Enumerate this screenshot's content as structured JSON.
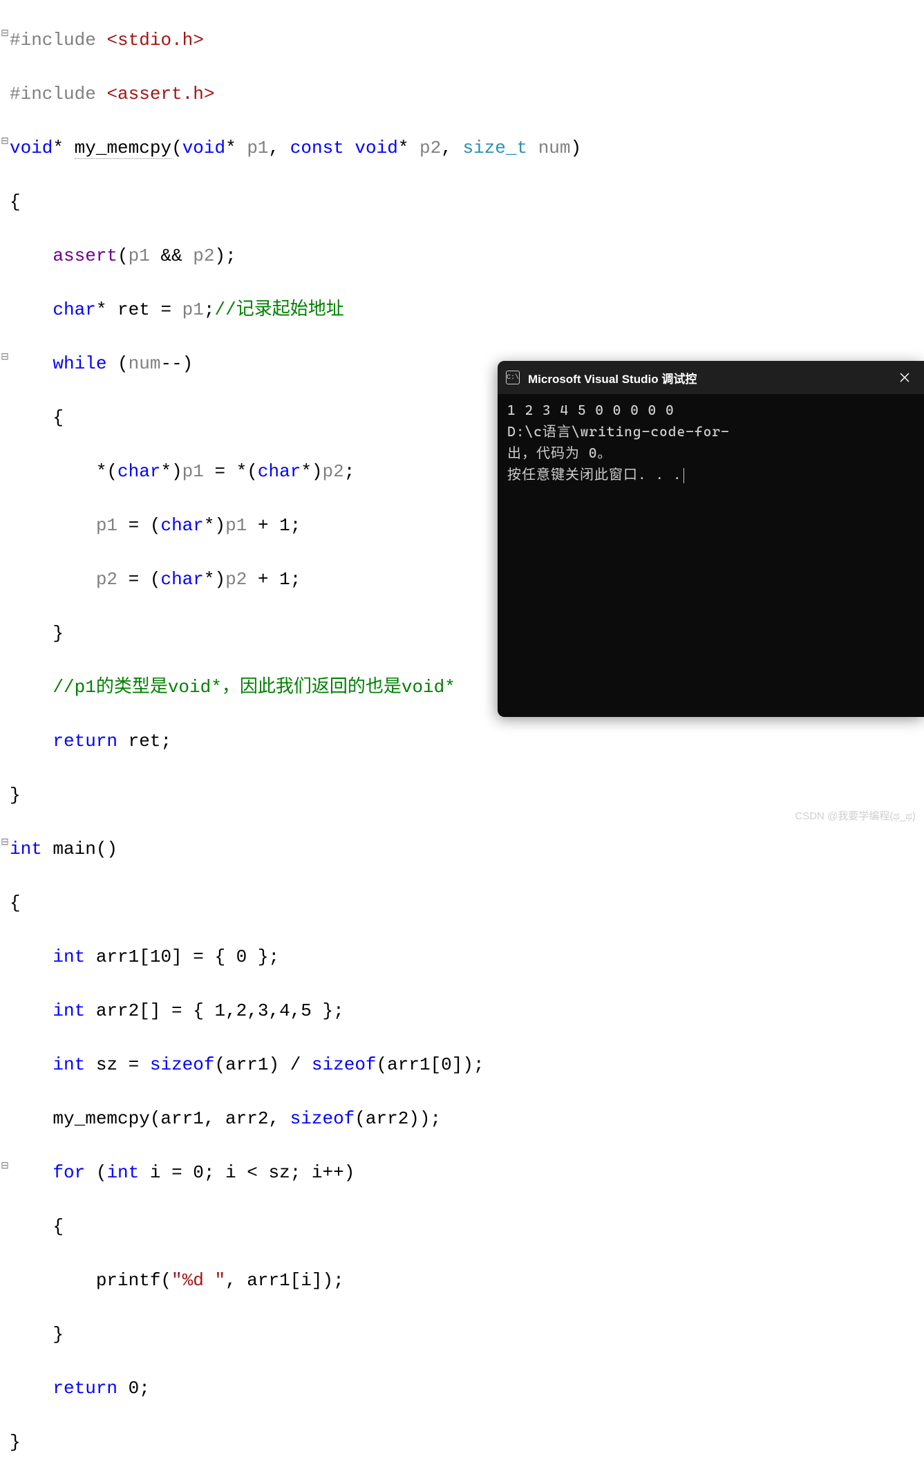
{
  "code": {
    "l1_gutter": "⊟",
    "l1_preproc": "#include ",
    "l1_path": "<stdio.h>",
    "l2_preproc": "#include ",
    "l2_path": "<assert.h>",
    "l3_gutter": "⊟",
    "l3_a": "void",
    "l3_b": "* ",
    "l3_c": "my_memcpy",
    "l3_d": "(",
    "l3_e": "void",
    "l3_f": "* ",
    "l3_g": "p1",
    "l3_h": ", ",
    "l3_i": "const",
    "l3_j": " ",
    "l3_k": "void",
    "l3_l": "* ",
    "l3_m": "p2",
    "l3_n": ", ",
    "l3_o": "size_t",
    "l3_p": " ",
    "l3_q": "num",
    "l3_r": ")",
    "l4": "{",
    "l5_a": "    ",
    "l5_b": "assert",
    "l5_c": "(",
    "l5_d": "p1",
    "l5_e": " && ",
    "l5_f": "p2",
    "l5_g": ");",
    "l6_a": "    ",
    "l6_b": "char",
    "l6_c": "* ret = ",
    "l6_d": "p1",
    "l6_e": ";",
    "l6_f": "//记录起始地址",
    "l7_gutter": "⊟",
    "l7_a": "    ",
    "l7_b": "while",
    "l7_c": " (",
    "l7_d": "num",
    "l7_e": "--)",
    "l8": "    {",
    "l9_a": "        *(",
    "l9_b": "char",
    "l9_c": "*)",
    "l9_d": "p1",
    "l9_e": " = *(",
    "l9_f": "char",
    "l9_g": "*)",
    "l9_h": "p2",
    "l9_i": ";",
    "l10_a": "        ",
    "l10_b": "p1",
    "l10_c": " = (",
    "l10_d": "char",
    "l10_e": "*)",
    "l10_f": "p1",
    "l10_g": " + 1;",
    "l11_a": "        ",
    "l11_b": "p2",
    "l11_c": " = (",
    "l11_d": "char",
    "l11_e": "*)",
    "l11_f": "p2",
    "l11_g": " + 1;",
    "l12": "    }",
    "l13_a": "    ",
    "l13_b": "//p1的类型是void*，因此我们返回的也是void*",
    "l14_a": "    ",
    "l14_b": "return",
    "l14_c": " ret;",
    "l15": "}",
    "l16_gutter": "⊟",
    "l16_a": "int",
    "l16_b": " main()",
    "l17": "{",
    "l18_a": "    ",
    "l18_b": "int",
    "l18_c": " arr1[10] = { 0 };",
    "l19_a": "    ",
    "l19_b": "int",
    "l19_c": " arr2[] = { 1,2,3,4,5 };",
    "l20_a": "    ",
    "l20_b": "int",
    "l20_c": " sz = ",
    "l20_d": "sizeof",
    "l20_e": "(arr1) / ",
    "l20_f": "sizeof",
    "l20_g": "(arr1[0]);",
    "l21_a": "    my_memcpy(arr1, arr2, ",
    "l21_b": "sizeof",
    "l21_c": "(arr2));",
    "l22_gutter": "⊟",
    "l22_a": "    ",
    "l22_b": "for",
    "l22_c": " (",
    "l22_d": "int",
    "l22_e": " i = 0; i < sz; i++)",
    "l23": "    {",
    "l24_a": "        printf(",
    "l24_b": "\"%d \"",
    "l24_c": ", arr1[i]);",
    "l25": "    }",
    "l26_a": "    ",
    "l26_b": "return",
    "l26_c": " 0;",
    "l27": "}"
  },
  "console": {
    "title": "Microsoft Visual Studio 调试控",
    "icon_text": "C:\\",
    "line1": "1 2 3 4 5 0 0 0 0 0",
    "line2": "D:\\c语言\\writing-code-for-",
    "line3": "出，代码为 0。",
    "line4": "按任意键关闭此窗口. . ."
  },
  "watermark": "CSDN @我要学编程(ಥ_ಥ)"
}
